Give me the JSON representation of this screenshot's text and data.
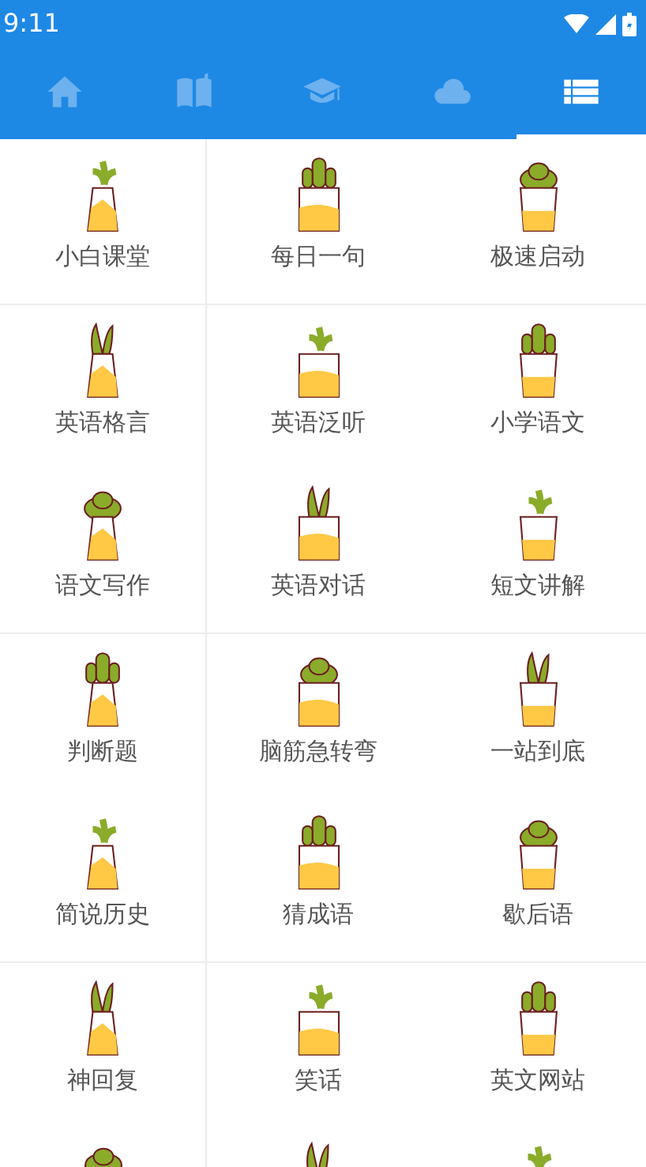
{
  "status_bar": {
    "time": "9:11"
  },
  "tabs": [
    {
      "kind": "home",
      "selected": false
    },
    {
      "kind": "book",
      "selected": false
    },
    {
      "kind": "cap",
      "selected": false
    },
    {
      "kind": "cloud",
      "selected": false
    },
    {
      "kind": "list",
      "selected": true
    }
  ],
  "sections": [
    {
      "items": [
        {
          "label": "小白课堂"
        },
        {
          "label": "每日一句"
        },
        {
          "label": "极速启动"
        }
      ]
    },
    {
      "items": [
        {
          "label": "英语格言"
        },
        {
          "label": "英语泛听"
        },
        {
          "label": "小学语文"
        },
        {
          "label": "语文写作"
        },
        {
          "label": "英语对话"
        },
        {
          "label": "短文讲解"
        }
      ]
    },
    {
      "items": [
        {
          "label": "判断题"
        },
        {
          "label": "脑筋急转弯"
        },
        {
          "label": "一站到底"
        },
        {
          "label": "简说历史"
        },
        {
          "label": "猜成语"
        },
        {
          "label": "歇后语"
        }
      ]
    },
    {
      "items": [
        {
          "label": "神回复"
        },
        {
          "label": "笑话"
        },
        {
          "label": "英文网站"
        },
        {
          "kind": "icon-only"
        },
        {
          "kind": "icon-only"
        },
        {
          "kind": "icon-only"
        }
      ]
    }
  ]
}
